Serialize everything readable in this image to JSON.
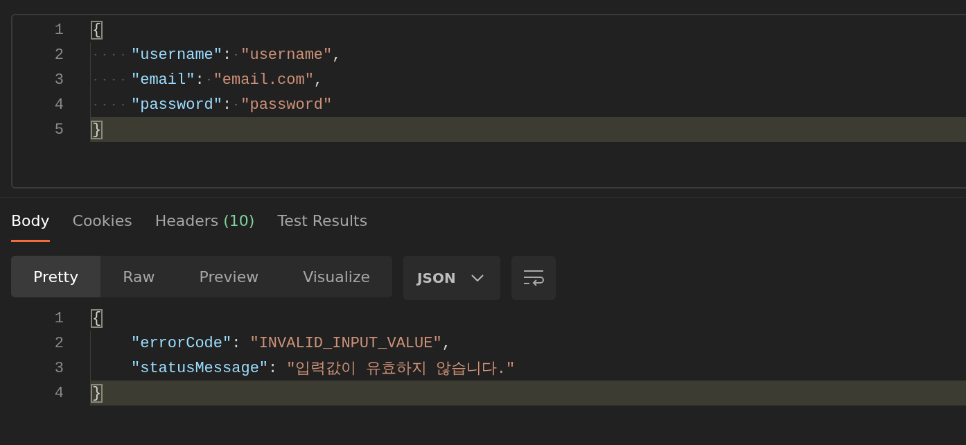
{
  "request_body": {
    "show_whitespace": true,
    "lines": [
      {
        "number": "1",
        "indented": false,
        "current": false,
        "tokens": [
          {
            "kind": "brace",
            "text": "{",
            "matched": true
          }
        ]
      },
      {
        "number": "2",
        "indented": true,
        "current": false,
        "tokens": [
          {
            "kind": "key",
            "text": "\"username\""
          },
          {
            "kind": "colon",
            "text": ":"
          },
          {
            "kind": "string",
            "text": "\"username\""
          },
          {
            "kind": "punct",
            "text": ","
          }
        ]
      },
      {
        "number": "3",
        "indented": true,
        "current": false,
        "tokens": [
          {
            "kind": "key",
            "text": "\"email\""
          },
          {
            "kind": "colon",
            "text": ":"
          },
          {
            "kind": "string",
            "text": "\"email.com\""
          },
          {
            "kind": "punct",
            "text": ","
          }
        ]
      },
      {
        "number": "4",
        "indented": true,
        "current": false,
        "tokens": [
          {
            "kind": "key",
            "text": "\"password\""
          },
          {
            "kind": "colon",
            "text": ":"
          },
          {
            "kind": "string",
            "text": "\"password\""
          }
        ]
      },
      {
        "number": "5",
        "indented": false,
        "current": true,
        "tokens": [
          {
            "kind": "brace",
            "text": "}",
            "matched": true
          }
        ]
      }
    ]
  },
  "response_tabs": [
    {
      "label": "Body",
      "selected": true
    },
    {
      "label": "Cookies",
      "selected": false
    },
    {
      "label": "Headers",
      "count": "(10)",
      "selected": false
    },
    {
      "label": "Test Results",
      "selected": false
    }
  ],
  "view_modes": [
    {
      "label": "Pretty",
      "selected": true
    },
    {
      "label": "Raw",
      "selected": false
    },
    {
      "label": "Preview",
      "selected": false
    },
    {
      "label": "Visualize",
      "selected": false
    }
  ],
  "format_dropdown": {
    "value": "JSON"
  },
  "response_body": {
    "show_whitespace": false,
    "lines": [
      {
        "number": "1",
        "indented": false,
        "current": false,
        "tokens": [
          {
            "kind": "brace",
            "text": "{",
            "matched": true
          }
        ]
      },
      {
        "number": "2",
        "indented": true,
        "current": false,
        "tokens": [
          {
            "kind": "key",
            "text": "\"errorCode\""
          },
          {
            "kind": "colon",
            "text": ":"
          },
          {
            "kind": "string",
            "text": "\"INVALID_INPUT_VALUE\""
          },
          {
            "kind": "punct",
            "text": ","
          }
        ]
      },
      {
        "number": "3",
        "indented": true,
        "current": false,
        "tokens": [
          {
            "kind": "key",
            "text": "\"statusMessage\""
          },
          {
            "kind": "colon",
            "text": ":"
          },
          {
            "kind": "string",
            "text": "\"입력값이 유효하지 않습니다.\""
          }
        ]
      },
      {
        "number": "4",
        "indented": false,
        "current": true,
        "tokens": [
          {
            "kind": "brace",
            "text": "}",
            "matched": true
          }
        ]
      }
    ]
  }
}
